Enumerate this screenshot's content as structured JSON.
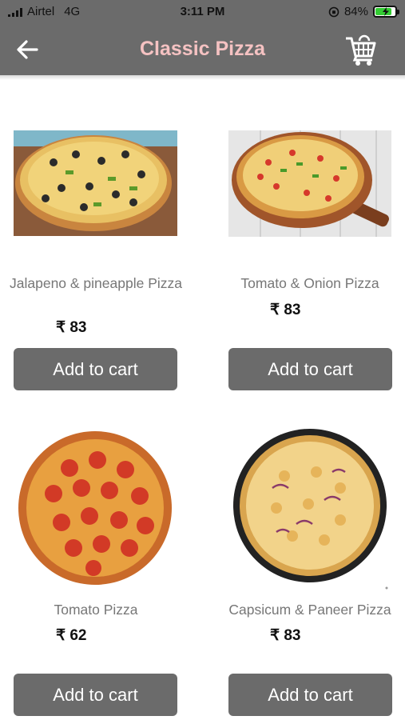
{
  "status_bar": {
    "carrier": "Airtel",
    "network": "4G",
    "time": "3:11 PM",
    "battery_percent": "84%",
    "battery_level": 0.84
  },
  "header": {
    "title": "Classic Pizza",
    "back_icon": "arrow-left-icon",
    "cart_icon": "shopping-cart-icon"
  },
  "products": [
    {
      "name": "Jalapeno & pineapple Pizza",
      "price": "₹ 83",
      "button": "Add to cart"
    },
    {
      "name": "Tomato & Onion Pizza",
      "price": "₹ 83",
      "button": "Add to cart"
    },
    {
      "name": "Tomato Pizza",
      "price": "₹ 62",
      "button": "Add to cart"
    },
    {
      "name": "Capsicum & Paneer Pizza",
      "price": "₹ 83",
      "button": "Add to cart"
    }
  ],
  "colors": {
    "bar": "#6b6b6b",
    "title": "#f5c2c2",
    "button": "#6b6b6b",
    "charging": "#33cc33"
  }
}
